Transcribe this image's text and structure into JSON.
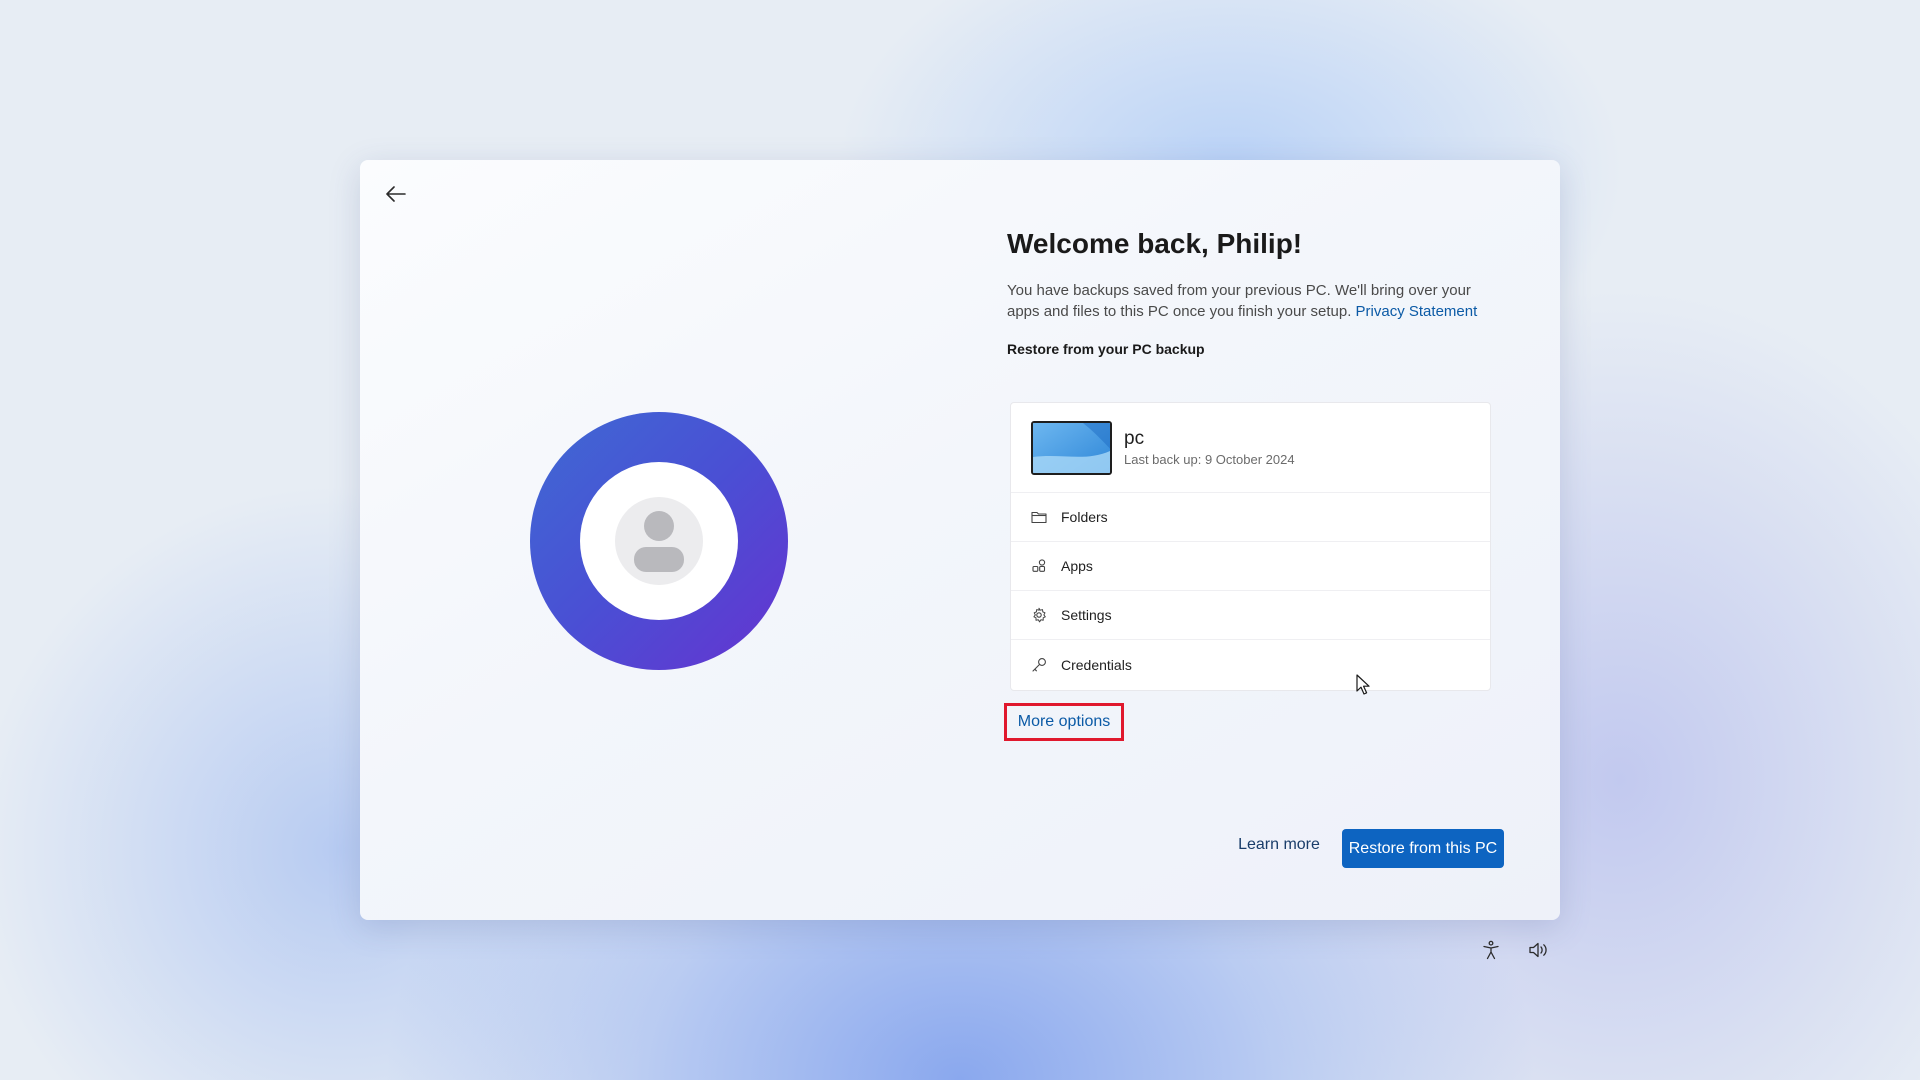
{
  "welcome": {
    "title": "Welcome back, Philip!",
    "description": "You have backups saved from your previous PC. We'll bring over your apps and files to this PC once you finish your setup.",
    "privacy_link": "Privacy Statement",
    "section_label": "Restore from your PC backup"
  },
  "backup": {
    "pc_name": "pc",
    "last_backup": "Last back up: 9 October 2024",
    "items": [
      {
        "label": "Folders",
        "icon": "folder-icon"
      },
      {
        "label": "Apps",
        "icon": "apps-icon"
      },
      {
        "label": "Settings",
        "icon": "gear-icon"
      },
      {
        "label": "Credentials",
        "icon": "key-icon"
      }
    ]
  },
  "actions": {
    "more_options": "More options",
    "learn_more": "Learn more",
    "restore": "Restore from this PC"
  },
  "icons": {
    "back": "back-arrow-icon",
    "accessibility": "accessibility-icon",
    "volume": "volume-icon"
  },
  "colors": {
    "accent": "#0d64c1",
    "link": "#0b5aa6",
    "highlight_border": "#e0182d",
    "avatar_gradient_start": "#3f6ad3",
    "avatar_gradient_end": "#6633d0"
  }
}
